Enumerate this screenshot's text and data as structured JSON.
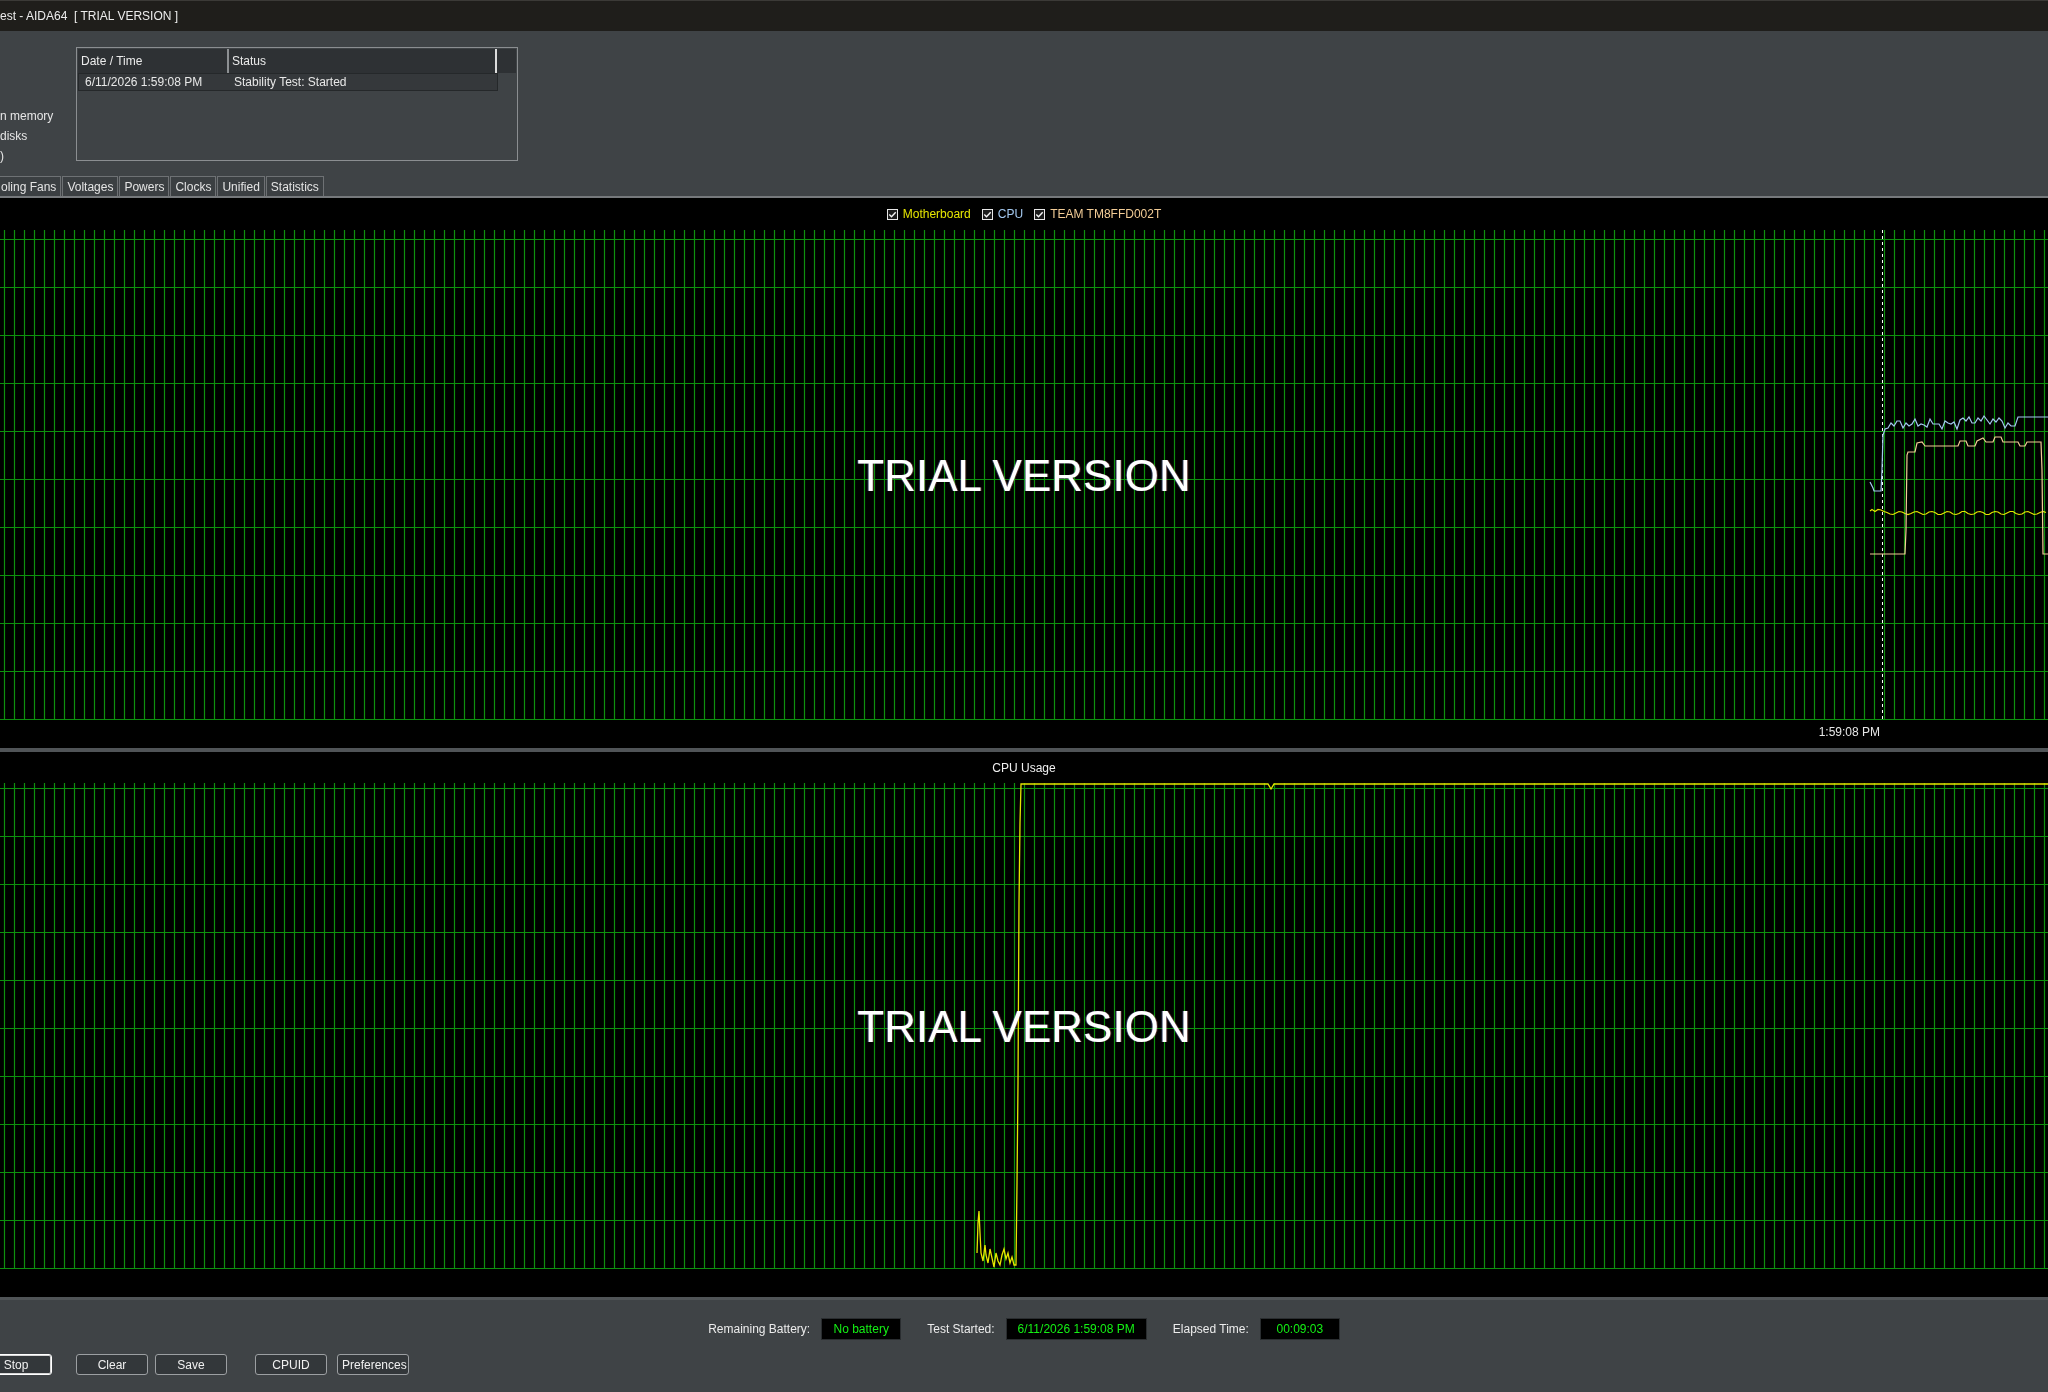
{
  "window": {
    "title": "est - AIDA64  [ TRIAL VERSION ]"
  },
  "options": [
    {
      "label": "n memory"
    },
    {
      "label": "disks"
    },
    {
      "label": ")"
    }
  ],
  "log": {
    "columns": [
      "Date / Time",
      "Status"
    ],
    "rows": [
      [
        "6/11/2026 1:59:08 PM",
        "Stability Test: Started"
      ]
    ]
  },
  "tabs": [
    {
      "label": "oling Fans",
      "selected": false
    },
    {
      "label": "Voltages",
      "selected": false
    },
    {
      "label": "Powers",
      "selected": false
    },
    {
      "label": "Clocks",
      "selected": false
    },
    {
      "label": "Unified",
      "selected": false
    },
    {
      "label": "Statistics",
      "selected": false
    }
  ],
  "temperature_chart": {
    "legend": [
      {
        "label": "Motherboard",
        "checked": true,
        "color": "#e6e600"
      },
      {
        "label": "CPU",
        "checked": true,
        "color": "#a3c8ef"
      },
      {
        "label": "TEAM TM8FFD002T",
        "checked": true,
        "color": "#f2cc96"
      }
    ],
    "watermark": "TRIAL VERSION",
    "time_label": "1:59:08 PM"
  },
  "cpu_chart": {
    "title": "CPU Usage",
    "watermark": "TRIAL VERSION"
  },
  "status": [
    {
      "label": "Remaining Battery:",
      "value": "No battery"
    },
    {
      "label": "Test Started:",
      "value": "6/11/2026 1:59:08 PM"
    },
    {
      "label": "Elapsed Time:",
      "value": "00:09:03"
    }
  ],
  "buttons": [
    {
      "label": "Stop",
      "focused": true
    },
    {
      "label": "Clear",
      "focused": false
    },
    {
      "label": "Save",
      "focused": false
    },
    {
      "label": "CPUID",
      "focused": false
    },
    {
      "label": "Preferences",
      "focused": false
    }
  ]
}
